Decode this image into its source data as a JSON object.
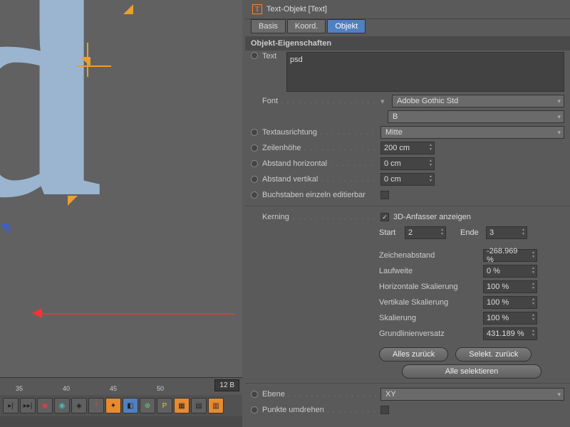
{
  "header": {
    "title": "Text-Objekt [Text]"
  },
  "tabs": {
    "basis": "Basis",
    "koord": "Koord.",
    "objekt": "Objekt"
  },
  "section": "Objekt-Eigenschaften",
  "props": {
    "text_label": "Text",
    "text_value": "psd",
    "font_label": "Font",
    "font_name": "Adobe Gothic Std",
    "font_weight": "B",
    "align_label": "Textausrichtung",
    "align_value": "Mitte",
    "lineheight_label": "Zeilenhöhe",
    "lineheight_value": "200 cm",
    "hspacing_label": "Abstand horizontal",
    "hspacing_value": "0 cm",
    "vspacing_label": "Abstand vertikal",
    "vspacing_value": "0 cm",
    "editchars_label": "Buchstaben einzeln editierbar",
    "kerning_label": "Kerning",
    "show3d_label": "3D-Anfasser anzeigen",
    "start_label": "Start",
    "start_value": "2",
    "end_label": "Ende",
    "end_value": "3",
    "charspacing_label": "Zeichenabstand",
    "charspacing_value": "-268.969 %",
    "tracking_label": "Laufweite",
    "tracking_value": "0 %",
    "hscale_label": "Horizontale Skalierung",
    "hscale_value": "100 %",
    "vscale_label": "Vertikale Skalierung",
    "vscale_value": "100 %",
    "scale_label": "Skalierung",
    "scale_value": "100 %",
    "baseline_label": "Grundlinienversatz",
    "baseline_value": "431.189 %",
    "reset_all": "Alles zurück",
    "reset_sel": "Selekt. zurück",
    "select_all": "Alle selektieren",
    "plane_label": "Ebene",
    "plane_value": "XY",
    "flip_label": "Punkte umdrehen"
  },
  "timeline": {
    "ticks": [
      "35",
      "40",
      "45",
      "50"
    ],
    "frame": "12 B"
  }
}
